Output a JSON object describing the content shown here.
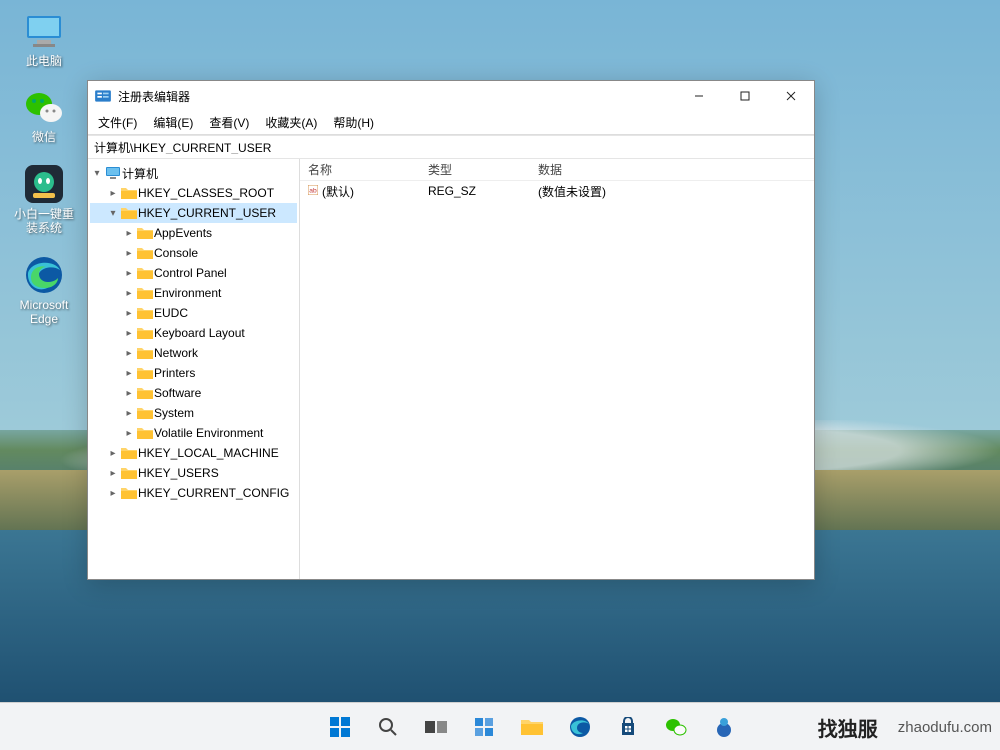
{
  "desktop": {
    "icons": [
      {
        "name": "此电脑",
        "icon": "pc"
      },
      {
        "name": "微信",
        "icon": "wechat"
      },
      {
        "name": "小白一键重装系统",
        "icon": "xiaobai"
      },
      {
        "name": "Microsoft Edge",
        "icon": "edge"
      }
    ]
  },
  "window": {
    "title": "注册表编辑器",
    "menu": [
      "文件(F)",
      "编辑(E)",
      "查看(V)",
      "收藏夹(A)",
      "帮助(H)"
    ],
    "address": "计算机\\HKEY_CURRENT_USER",
    "tree_root": "计算机",
    "tree_top": [
      {
        "label": "HKEY_CLASSES_ROOT",
        "exp": false
      }
    ],
    "tree_selected": "HKEY_CURRENT_USER",
    "tree_children": [
      "AppEvents",
      "Console",
      "Control Panel",
      "Environment",
      "EUDC",
      "Keyboard Layout",
      "Network",
      "Printers",
      "Software",
      "System",
      "Volatile Environment"
    ],
    "tree_bottom": [
      "HKEY_LOCAL_MACHINE",
      "HKEY_USERS",
      "HKEY_CURRENT_CONFIG"
    ],
    "columns": [
      "名称",
      "类型",
      "数据"
    ],
    "rows": [
      {
        "name": "(默认)",
        "type": "REG_SZ",
        "data": "(数值未设置)"
      }
    ]
  },
  "taskbar": {
    "right_brand": "找独服",
    "right_url": "zhaodufu.com"
  }
}
